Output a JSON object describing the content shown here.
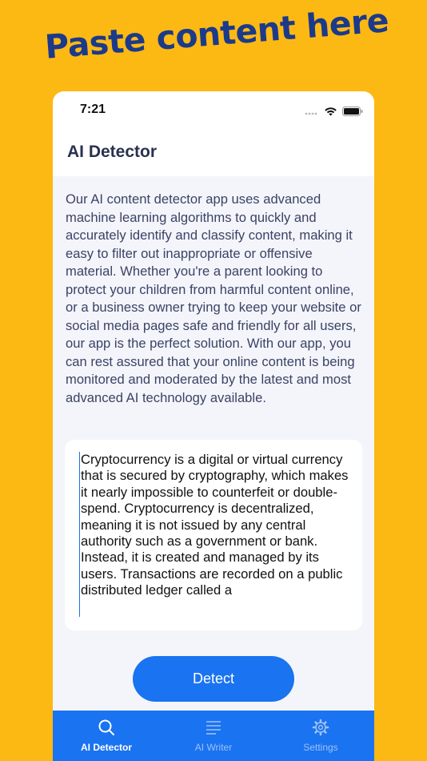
{
  "headline": "Paste content here",
  "status_bar": {
    "time": "7:21"
  },
  "nav": {
    "title": "AI Detector"
  },
  "description": "Our AI content detector app uses advanced machine learning algorithms to quickly and accurately identify and classify content, making it easy to filter out inappropriate or offensive material. Whether you're a parent looking to protect your children from harmful content online, or a business owner trying to keep your website or social media pages safe and friendly for all users, our app is the perfect solution. With our app, you can rest assured that your online content is being monitored and moderated by the latest and most advanced AI technology available.",
  "input": {
    "value": "Cryptocurrency is a digital or virtual currency that is secured by cryptography, which makes it nearly impossible to counterfeit or double-spend. Cryptocurrency is decentralized, meaning it is not issued by any central authority such as a government or bank. Instead, it is created and managed by its users. Transactions are recorded on a public distributed ledger called a"
  },
  "detect_button": {
    "label": "Detect"
  },
  "tabs": [
    {
      "label": "AI Detector",
      "icon": "search-icon",
      "active": true
    },
    {
      "label": "AI Writer",
      "icon": "lines-icon",
      "active": false
    },
    {
      "label": "Settings",
      "icon": "gear-icon",
      "active": false
    }
  ],
  "colors": {
    "background": "#FDB913",
    "headline": "#1C3A8A",
    "accent": "#1A73F0",
    "tab_inactive": "#9DC2F7"
  }
}
